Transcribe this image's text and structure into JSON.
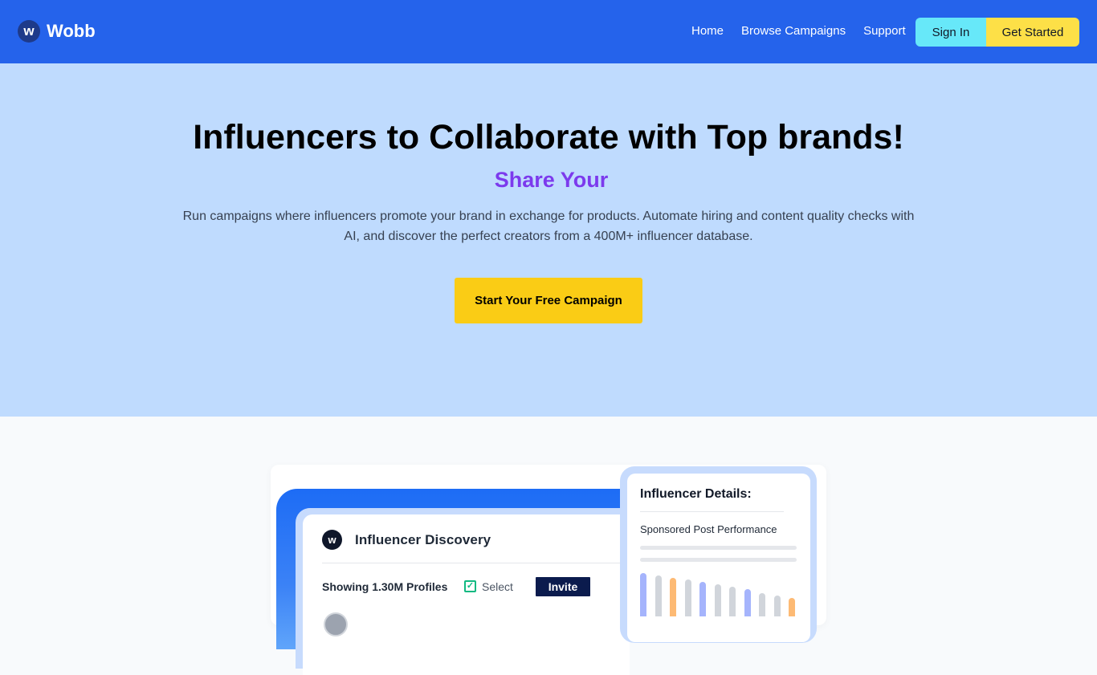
{
  "nav": {
    "logo_letter": "w",
    "brand": "Wobb",
    "links": [
      "Home",
      "Browse Campaigns",
      "Support"
    ],
    "sign_in": "Sign In",
    "get_started": "Get Started"
  },
  "hero": {
    "title": "Influencers to Collaborate with Top brands!",
    "subtitle": "Share Your",
    "description": "Run campaigns where influencers promote your brand in exchange for products. Automate hiring and content quality checks with AI, and discover the perfect creators from a 400M+ influencer database.",
    "cta": "Start Your Free Campaign"
  },
  "discovery": {
    "logo_letter": "w",
    "title": "Influencer Discovery",
    "count": "Showing 1.30M Profiles",
    "select": "Select",
    "invite": "Invite"
  },
  "details": {
    "title": "Influencer Details:",
    "subtitle": "Sponsored Post Performance",
    "bars": [
      {
        "value": 0.95,
        "color": "#a5b4fc"
      },
      {
        "value": 0.9,
        "color": "#d1d5db"
      },
      {
        "value": 0.85,
        "color": "#fdba74"
      },
      {
        "value": 0.8,
        "color": "#d1d5db"
      },
      {
        "value": 0.75,
        "color": "#a5b4fc"
      },
      {
        "value": 0.7,
        "color": "#d1d5db"
      },
      {
        "value": 0.65,
        "color": "#d1d5db"
      },
      {
        "value": 0.6,
        "color": "#a5b4fc"
      },
      {
        "value": 0.5,
        "color": "#d1d5db"
      },
      {
        "value": 0.45,
        "color": "#d1d5db"
      },
      {
        "value": 0.4,
        "color": "#fdba74"
      }
    ]
  },
  "colors": {
    "nav_bg": "#2563eb",
    "hero_bg": "#bfdbfe",
    "accent_purple": "#7c3aed",
    "cta_yellow": "#facc15",
    "sign_in_cyan": "#67e8f9"
  }
}
